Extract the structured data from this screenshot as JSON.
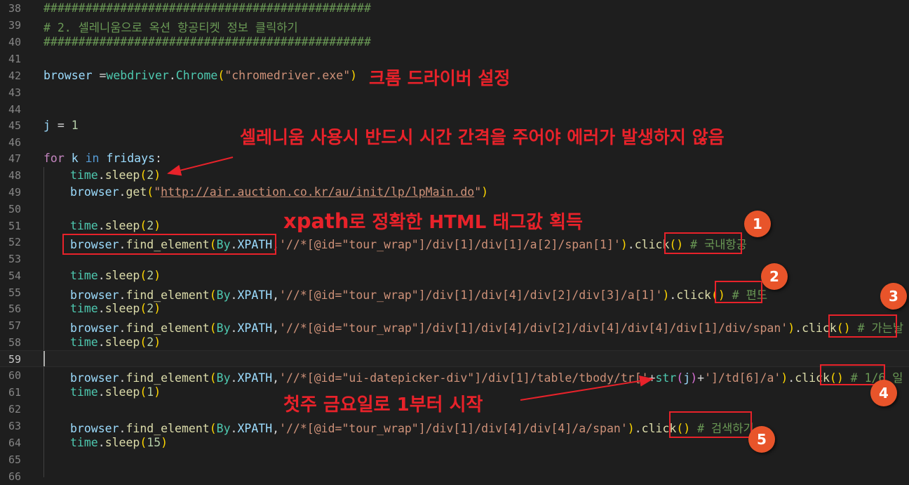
{
  "lines": {
    "l38": {
      "num": "38",
      "comment": "###############################################"
    },
    "l39": {
      "num": "39",
      "comment": "# 2. 셀레니움으로 옥션 항공티켓 정보 클릭하기"
    },
    "l40": {
      "num": "40",
      "comment": "###############################################"
    },
    "l41": {
      "num": "41"
    },
    "l42": {
      "num": "42",
      "var": "browser",
      "op": " =",
      "mod": "webdriver",
      "dot": ".",
      "cls": "Chrome",
      "p1": "(",
      "str": "\"chromedriver.exe\"",
      "p2": ")"
    },
    "l43": {
      "num": "43"
    },
    "l44": {
      "num": "44"
    },
    "l45": {
      "num": "45",
      "var": "j",
      "op": " = ",
      "num_val": "1"
    },
    "l46": {
      "num": "46"
    },
    "l47": {
      "num": "47",
      "kw": "for",
      "var1": "k",
      "in": "in",
      "var2": "fridays",
      "colon": ":"
    },
    "l48": {
      "num": "48",
      "mod": "time",
      "dot": ".",
      "fn": "sleep",
      "p1": "(",
      "arg": "2",
      "p2": ")"
    },
    "l49": {
      "num": "49",
      "var": "browser",
      "dot": ".",
      "fn": "get",
      "p1": "(",
      "q1": "\"",
      "url": "http://air.auction.co.kr/au/init/lp/lpMain.do",
      "q2": "\"",
      "p2": ")"
    },
    "l50": {
      "num": "50"
    },
    "l51": {
      "num": "51",
      "mod": "time",
      "dot": ".",
      "fn": "sleep",
      "p1": "(",
      "arg": "2",
      "p2": ")"
    },
    "l52": {
      "num": "52",
      "var": "browser",
      "dot": ".",
      "fn": "find_element",
      "p1": "(",
      "by": "By",
      "dot2": ".",
      "xp": "XPATH",
      "comma": ",",
      "str": "'//*[@id=\"tour_wrap\"]/div[1]/div[1]/a[2]/span[1]'",
      "p2": ")",
      "dot3": ".",
      "click": "click",
      "p3": "()",
      "comment": " # 국내항공"
    },
    "l53": {
      "num": "53"
    },
    "l54": {
      "num": "54",
      "mod": "time",
      "dot": ".",
      "fn": "sleep",
      "p1": "(",
      "arg": "2",
      "p2": ")"
    },
    "l55": {
      "num": "55",
      "var": "browser",
      "dot": ".",
      "fn": "find_element",
      "p1": "(",
      "by": "By",
      "dot2": ".",
      "xp": "XPATH",
      "comma": ",",
      "str": "'//*[@id=\"tour_wrap\"]/div[1]/div[4]/div[2]/div[3]/a[1]'",
      "p2": ")",
      "dot3": ".",
      "click": "click",
      "p3": "()",
      "comment": " # 편도"
    },
    "l56": {
      "num": "56",
      "mod": "time",
      "dot": ".",
      "fn": "sleep",
      "p1": "(",
      "arg": "2",
      "p2": ")"
    },
    "l57": {
      "num": "57",
      "var": "browser",
      "dot": ".",
      "fn": "find_element",
      "p1": "(",
      "by": "By",
      "dot2": ".",
      "xp": "XPATH",
      "comma": ",",
      "str": "'//*[@id=\"tour_wrap\"]/div[1]/div[4]/div[2]/div[4]/div[4]/div[1]/div/span'",
      "p2": ")",
      "dot3": ".",
      "click": "click",
      "p3": "()",
      "comment": " # 가는날"
    },
    "l58": {
      "num": "58",
      "mod": "time",
      "dot": ".",
      "fn": "sleep",
      "p1": "(",
      "arg": "2",
      "p2": ")"
    },
    "l59": {
      "num": "59"
    },
    "l60": {
      "num": "60",
      "var": "browser",
      "dot": ".",
      "fn": "find_element",
      "p1": "(",
      "by": "By",
      "dot2": ".",
      "xp": "XPATH",
      "comma": ",",
      "str1": "'//*[@id=\"ui-datepicker-div\"]/div[1]/table/tbody/tr['",
      "plus1": "+",
      "strfn": "str",
      "pp1": "(",
      "jv": "j",
      "pp2": ")",
      "plus2": "+",
      "str2": "']/td[6]/a'",
      "p2": ")",
      "dot3": ".",
      "click": "click",
      "p3": "()",
      "comment": " # 1/6 일"
    },
    "l61": {
      "num": "61",
      "mod": "time",
      "dot": ".",
      "fn": "sleep",
      "p1": "(",
      "arg": "1",
      "p2": ")"
    },
    "l62": {
      "num": "62"
    },
    "l63": {
      "num": "63",
      "var": "browser",
      "dot": ".",
      "fn": "find_element",
      "p1": "(",
      "by": "By",
      "dot2": ".",
      "xp": "XPATH",
      "comma": ",",
      "str": "'//*[@id=\"tour_wrap\"]/div[1]/div[4]/div[4]/a/span'",
      "p2": ")",
      "dot3": ".",
      "click": "click",
      "p3": "()",
      "comment": " # 검색하기"
    },
    "l64": {
      "num": "64",
      "mod": "time",
      "dot": ".",
      "fn": "sleep",
      "p1": "(",
      "arg": "15",
      "p2": ")"
    },
    "l65": {
      "num": "65"
    },
    "l66": {
      "num": "66"
    }
  },
  "annotations": {
    "chrome_driver": "크롬 드라이버 설정",
    "sleep_note": "셀레니움 사용시 반드시 시간 간격을 주어야 에러가 발생하지 않음",
    "xpath_bold": "xpath",
    "xpath_rest": "로 정확한 HTML 태그값 획득",
    "friday_note": "첫주 금요일로 1부터 시작"
  },
  "badges": {
    "b1": "1",
    "b2": "2",
    "b3": "3",
    "b4": "4",
    "b5": "5"
  },
  "colors": {
    "background": "#1e1e1e",
    "annotation": "#e8222a",
    "badge": "#e8542a"
  }
}
